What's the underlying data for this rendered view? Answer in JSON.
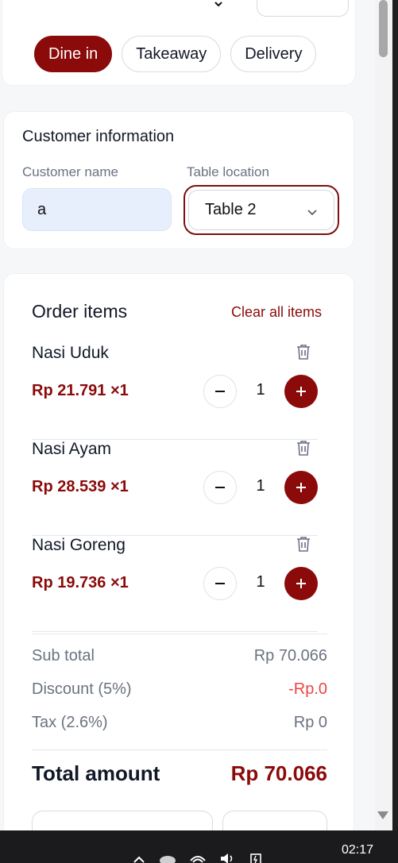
{
  "order_types": {
    "dine_in": "Dine in",
    "takeaway": "Takeaway",
    "delivery": "Delivery",
    "selected": "Dine in"
  },
  "customer": {
    "title": "Customer information",
    "name_label": "Customer name",
    "name_value": "a",
    "table_label": "Table location",
    "table_value": "Table 2"
  },
  "order": {
    "title": "Order items",
    "clear_label": "Clear all items",
    "items": [
      {
        "name": "Nasi Uduk",
        "price": "Rp 21.791 ×1",
        "qty": "1"
      },
      {
        "name": "Nasi Ayam",
        "price": "Rp 28.539 ×1",
        "qty": "1"
      },
      {
        "name": "Nasi Goreng",
        "price": "Rp 19.736 ×1",
        "qty": "1"
      }
    ]
  },
  "summary": {
    "subtotal_label": "Sub total",
    "subtotal_value": "Rp 70.066",
    "discount_label": "Discount (5%)",
    "discount_value": "-Rp.0",
    "tax_label": "Tax (2.6%)",
    "tax_value": "Rp 0",
    "total_label": "Total amount",
    "total_value": "Rp 70.066"
  },
  "taskbar": {
    "time": "02:17"
  },
  "colors": {
    "accent": "#8b0a0a",
    "discount": "#ef4444",
    "input_bg": "#e8effc"
  }
}
